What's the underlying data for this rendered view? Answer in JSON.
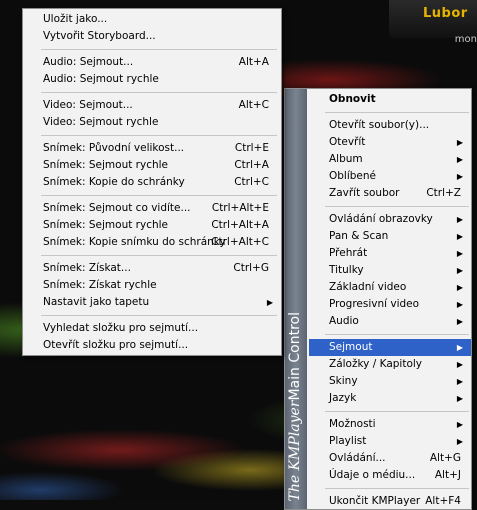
{
  "top": {
    "user_name": "Lubor",
    "sub_text": "mon"
  },
  "main_menu": {
    "side_brand": "The KMPlayer",
    "side_title": "Main Control",
    "items": [
      {
        "label": "Obnovit",
        "bold": true
      },
      {
        "sep": true
      },
      {
        "label": "Otevřít soubor(y)..."
      },
      {
        "label": "Otevřít",
        "arrow": true
      },
      {
        "label": "Album",
        "arrow": true
      },
      {
        "label": "Oblíbené",
        "arrow": true
      },
      {
        "label": "Zavřít soubor",
        "shortcut": "Ctrl+Z"
      },
      {
        "sep": true
      },
      {
        "label": "Ovládání obrazovky",
        "arrow": true
      },
      {
        "label": "Pan & Scan",
        "arrow": true
      },
      {
        "label": "Přehrát",
        "arrow": true
      },
      {
        "label": "Titulky",
        "arrow": true
      },
      {
        "label": "Základní video",
        "arrow": true
      },
      {
        "label": "Progresivní video",
        "arrow": true
      },
      {
        "label": "Audio",
        "arrow": true
      },
      {
        "sep": true
      },
      {
        "label": "Sejmout",
        "arrow": true,
        "highlight": true
      },
      {
        "label": "Záložky / Kapitoly",
        "arrow": true
      },
      {
        "label": "Skiny",
        "arrow": true
      },
      {
        "label": "Jazyk",
        "arrow": true
      },
      {
        "sep": true
      },
      {
        "label": "Možnosti",
        "arrow": true
      },
      {
        "label": "Playlist",
        "arrow": true
      },
      {
        "label": "Ovládání...",
        "shortcut": "Alt+G"
      },
      {
        "label": "Údaje o médiu...",
        "shortcut": "Alt+J"
      },
      {
        "sep": true
      },
      {
        "label": "Ukončit KMPlayer",
        "shortcut": "Alt+F4"
      }
    ]
  },
  "capture_submenu": {
    "items": [
      {
        "label": "Uložit jako..."
      },
      {
        "label": "Vytvořit Storyboard..."
      },
      {
        "sep": true
      },
      {
        "label": "Audio: Sejmout...",
        "shortcut": "Alt+A"
      },
      {
        "label": "Audio: Sejmout rychle"
      },
      {
        "sep": true
      },
      {
        "label": "Video: Sejmout...",
        "shortcut": "Alt+C"
      },
      {
        "label": "Video: Sejmout rychle"
      },
      {
        "sep": true
      },
      {
        "label": "Snímek: Původní velikost...",
        "shortcut": "Ctrl+E"
      },
      {
        "label": "Snímek: Sejmout rychle",
        "shortcut": "Ctrl+A"
      },
      {
        "label": "Snímek: Kopie do schránky",
        "shortcut": "Ctrl+C"
      },
      {
        "sep": true
      },
      {
        "label": "Snímek: Sejmout co vidíte...",
        "shortcut": "Ctrl+Alt+E"
      },
      {
        "label": "Snímek: Sejmout rychle",
        "shortcut": "Ctrl+Alt+A"
      },
      {
        "label": "Snímek: Kopie snímku do schránky",
        "shortcut": "Ctrl+Alt+C"
      },
      {
        "sep": true
      },
      {
        "label": "Snímek: Získat...",
        "shortcut": "Ctrl+G"
      },
      {
        "label": "Snímek: Získat rychle"
      },
      {
        "label": "Nastavit jako tapetu",
        "arrow": true
      },
      {
        "sep": true
      },
      {
        "label": "Vyhledat složku pro sejmutí..."
      },
      {
        "label": "Otevřít složku pro sejmutí..."
      }
    ]
  }
}
